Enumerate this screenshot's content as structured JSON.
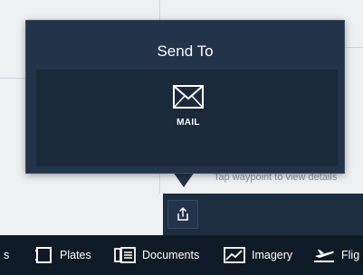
{
  "popover": {
    "title": "Send To",
    "actions": [
      {
        "label": "MAIL",
        "icon": "mail-icon"
      }
    ]
  },
  "background": {
    "hint": "Tap waypoint to view details"
  },
  "toolbar": {
    "share_icon": "share-icon"
  },
  "tabbar": {
    "tabs": [
      {
        "label": "s",
        "icon": "none"
      },
      {
        "label": "Plates",
        "icon": "plates-icon"
      },
      {
        "label": "Documents",
        "icon": "documents-icon"
      },
      {
        "label": "Imagery",
        "icon": "imagery-icon"
      },
      {
        "label": "Flig",
        "icon": "flight-icon"
      }
    ]
  },
  "colors": {
    "popover_bg": "#233349",
    "action_bg": "#1b2a3b",
    "tabbar_bg": "#0f1a27",
    "text": "#ffffff"
  }
}
